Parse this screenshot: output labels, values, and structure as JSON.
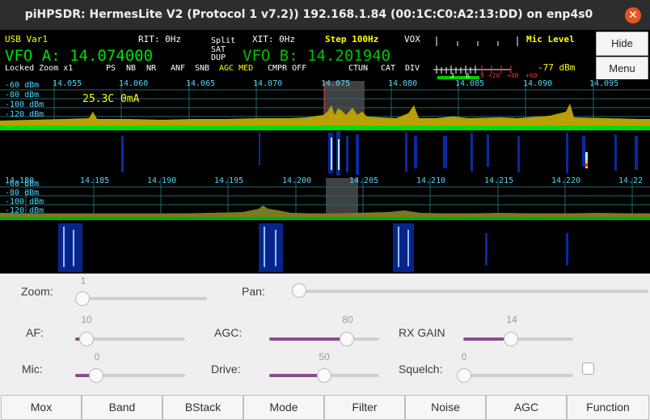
{
  "window": {
    "title": "piHPSDR: HermesLite V2 (Protocol 1 v7.2)) 192.168.1.84 (00:1C:C0:A2:13:DD) on enp4s0",
    "close_glyph": "✕"
  },
  "header": {
    "mode_filter": "USB Var1",
    "rit": "RIT: 0Hz",
    "split": "Split",
    "sat": "SAT",
    "dup": "DUP",
    "xit": "XIT: 0Hz",
    "step": "Step 100Hz",
    "vox": "VOX",
    "mic_level": "Mic Level",
    "vfo_a": "VFO A: 14.074000",
    "vfo_b": "VFO B: 14.201940",
    "meter_value": "-77 dBm",
    "status_left": "Locked Zoom x1",
    "status_items": [
      "PS",
      "NB",
      "NR",
      "ANF",
      "SNB"
    ],
    "agc_text": "AGC MED",
    "cmpr": "CMPR OFF",
    "status_right": [
      "CTUN",
      "CAT",
      "DIV"
    ],
    "scale_white": [
      "3",
      "6"
    ],
    "scale_red": [
      "9",
      "+20",
      "+40",
      "+60"
    ],
    "mic_level_fraction": 0.5
  },
  "side_buttons": {
    "hide": "Hide",
    "menu": "Menu"
  },
  "panadapter1": {
    "freqs": [
      "14.055",
      "14.060",
      "14.065",
      "14.070",
      "14.075",
      "14.080",
      "14.085",
      "14.090",
      "14.095"
    ],
    "dbm": [
      "-60 dBm",
      "-80 dBm",
      "-100 dBm",
      "-120 dBm"
    ],
    "info": "25.3C 0mA"
  },
  "panadapter2": {
    "freqs": [
      "14.180",
      "14.185",
      "14.190",
      "14.195",
      "14.200",
      "14.205",
      "14.210",
      "14.215",
      "14.220",
      "14.22"
    ],
    "dbm": [
      "-60 dBm",
      "-80 dBm",
      "-100 dBm",
      "-120 dBm"
    ]
  },
  "controls": {
    "zoom": {
      "label": "Zoom:",
      "value": "1"
    },
    "pan": {
      "label": "Pan:",
      "value": "0"
    },
    "af": {
      "label": "AF:",
      "value": "10"
    },
    "agc": {
      "label": "AGC:",
      "value": "80"
    },
    "rxgain": {
      "label": "RX GAIN",
      "value": "14"
    },
    "mic": {
      "label": "Mic:",
      "value": "0"
    },
    "drive": {
      "label": "Drive:",
      "value": "50"
    },
    "squelch": {
      "label": "Squelch:",
      "value": "0",
      "enabled": false
    }
  },
  "buttons": [
    "Mox",
    "Band",
    "BStack",
    "Mode",
    "Filter",
    "Noise",
    "AGC",
    "Function"
  ],
  "colors": {
    "green": "#00e000",
    "yellow": "#ffff00",
    "cyan": "#4fd8ff",
    "purple": "#8a4f8a"
  }
}
